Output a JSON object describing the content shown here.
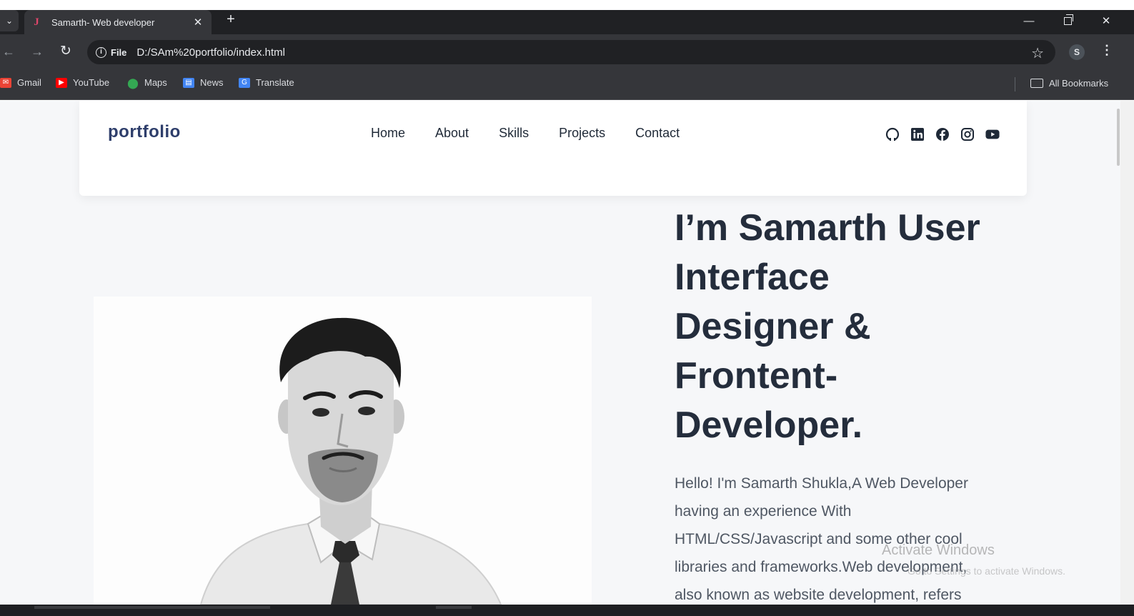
{
  "browser": {
    "tab": {
      "title": "Samarth- Web developer",
      "favicon": "J"
    },
    "new_tab_glyph": "+",
    "address": {
      "scheme_label": "File",
      "url": "D:/SAm%20portfolio/index.html"
    },
    "profile_initial": "S",
    "bookmarks": [
      {
        "label": "Gmail",
        "icon": "gmail-icon"
      },
      {
        "label": "YouTube",
        "icon": "youtube-icon"
      },
      {
        "label": "Maps",
        "icon": "maps-icon"
      },
      {
        "label": "News",
        "icon": "news-icon"
      },
      {
        "label": "Translate",
        "icon": "translate-icon"
      }
    ],
    "all_bookmarks_label": "All Bookmarks"
  },
  "site": {
    "logo": "portfolio",
    "nav": [
      "Home",
      "About",
      "Skills",
      "Projects",
      "Contact"
    ],
    "socials": [
      "github-icon",
      "linkedin-icon",
      "facebook-icon",
      "instagram-icon",
      "youtube-icon"
    ],
    "hero": {
      "title_lines": [
        "I’m Samarth User",
        "Interface",
        "Designer &",
        "Frontent-",
        "Developer."
      ],
      "description_lines": [
        "Hello! I'm Samarth Shukla,A Web Developer",
        "having an experience With",
        "HTML/CSS/Javascript and some other cool",
        "libraries and frameworks.Web development,",
        "also known as website development, refers"
      ]
    }
  },
  "os_overlay": {
    "activate_title": "Activate Windows",
    "activate_sub": "Go to Settings to activate Windows."
  },
  "colors": {
    "logo": "#2e3e6b",
    "heading": "#242d3c",
    "body_text": "#4f5763",
    "page_bg": "#f6f7f9",
    "chrome_dark": "#202124",
    "chrome_toolbar": "#35363a"
  }
}
